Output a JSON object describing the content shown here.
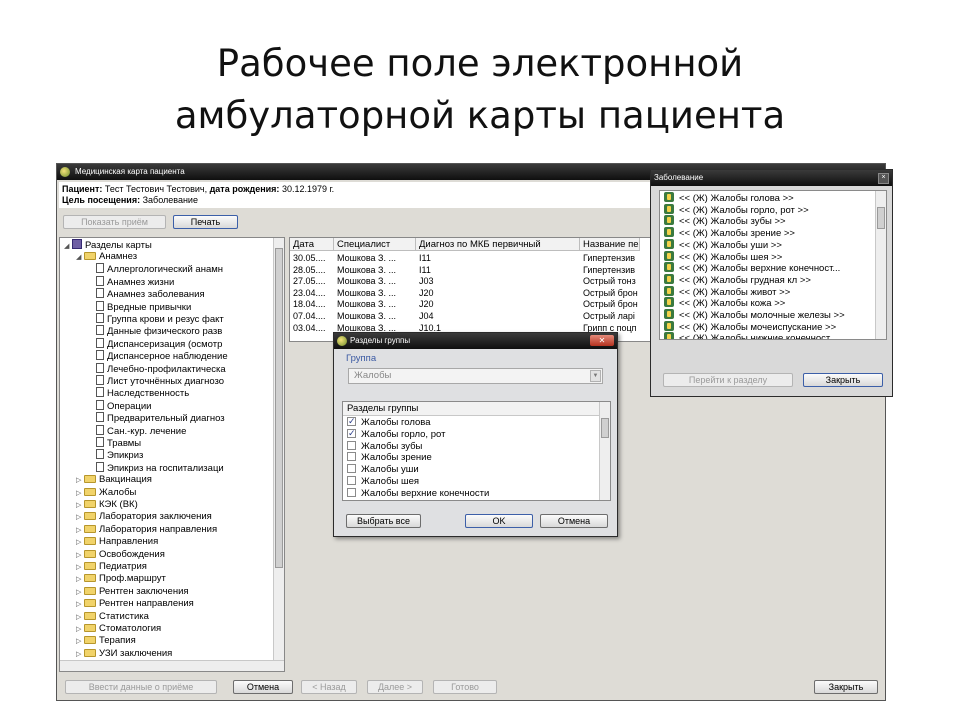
{
  "slide": {
    "title_line1": "Рабочее поле электронной",
    "title_line2": "амбулаторной карты пациента"
  },
  "main_window": {
    "title": "Медицинская карта пациента",
    "patient_label": "Пациент:",
    "patient_name": "Тест Тестович Тестович,",
    "birth_label": "дата рождения:",
    "birth_date": "30.12.1979 г.",
    "visit_label": "Цель посещения:",
    "visit_value": "Заболевание",
    "show_visit_button": "Показать приём",
    "print_button": "Печать",
    "bottom": {
      "enter_data": "Ввести данные о приёме",
      "cancel": "Отмена",
      "back": "< Назад",
      "next": "Далее >",
      "done": "Готово",
      "close": "Закрыть"
    }
  },
  "tree": {
    "root": "Разделы карты",
    "items": [
      {
        "label": "Анамнез",
        "type": "folder",
        "level": 1,
        "expanded": true
      },
      {
        "label": "Аллергологический анамн",
        "type": "doc",
        "level": 2
      },
      {
        "label": "Анамнез жизни",
        "type": "doc",
        "level": 2
      },
      {
        "label": "Анамнез заболевания",
        "type": "doc",
        "level": 2
      },
      {
        "label": "Вредные привычки",
        "type": "doc",
        "level": 2
      },
      {
        "label": "Группа крови и резус факт",
        "type": "doc",
        "level": 2
      },
      {
        "label": "Данные физического разв",
        "type": "doc",
        "level": 2
      },
      {
        "label": "Диспансеризация (осмотр",
        "type": "doc",
        "level": 2
      },
      {
        "label": "Диспансерное наблюдение",
        "type": "doc",
        "level": 2
      },
      {
        "label": "Лечебно-профилактическа",
        "type": "doc",
        "level": 2
      },
      {
        "label": "Лист уточнённых диагнозо",
        "type": "doc",
        "level": 2
      },
      {
        "label": "Наследственность",
        "type": "doc",
        "level": 2
      },
      {
        "label": "Операции",
        "type": "doc",
        "level": 2
      },
      {
        "label": "Предварительный диагноз",
        "type": "doc",
        "level": 2
      },
      {
        "label": "Сан.-кур. лечение",
        "type": "doc",
        "level": 2
      },
      {
        "label": "Травмы",
        "type": "doc",
        "level": 2
      },
      {
        "label": "Эпикриз",
        "type": "doc",
        "level": 2
      },
      {
        "label": "Эпикриз на госпитализаци",
        "type": "doc",
        "level": 2
      },
      {
        "label": "Вакцинация",
        "type": "folder",
        "level": 1
      },
      {
        "label": "Жалобы",
        "type": "folder",
        "level": 1
      },
      {
        "label": "КЭК (ВК)",
        "type": "folder",
        "level": 1
      },
      {
        "label": "Лаборатория заключения",
        "type": "folder",
        "level": 1
      },
      {
        "label": "Лаборатория направления",
        "type": "folder",
        "level": 1
      },
      {
        "label": "Направления",
        "type": "folder",
        "level": 1
      },
      {
        "label": "Освобождения",
        "type": "folder",
        "level": 1
      },
      {
        "label": "Педиатрия",
        "type": "folder",
        "level": 1
      },
      {
        "label": "Проф.маршрут",
        "type": "folder",
        "level": 1
      },
      {
        "label": "Рентген заключения",
        "type": "folder",
        "level": 1
      },
      {
        "label": "Рентген направления",
        "type": "folder",
        "level": 1
      },
      {
        "label": "Статистика",
        "type": "folder",
        "level": 1
      },
      {
        "label": "Стоматология",
        "type": "folder",
        "level": 1
      },
      {
        "label": "Терапия",
        "type": "folder",
        "level": 1
      },
      {
        "label": "УЗИ заключения",
        "type": "folder",
        "level": 1
      }
    ]
  },
  "visits_table": {
    "columns": [
      "Дата",
      "Специалист",
      "Диагноз по МКБ первичный",
      "Название пе"
    ],
    "rows": [
      [
        "30.05....",
        "Мошкова З. ...",
        "I11",
        "Гипертензив"
      ],
      [
        "28.05....",
        "Мошкова З. ...",
        "I11",
        "Гипертензив"
      ],
      [
        "27.05....",
        "Мошкова З. ...",
        "J03",
        "Острый тонз"
      ],
      [
        "23.04....",
        "Мошкова З. ...",
        "J20",
        "Острый брон"
      ],
      [
        "18.04....",
        "Мошкова З. ...",
        "J20",
        "Острый брон"
      ],
      [
        "07.04....",
        "Мошкова З. ...",
        "J04",
        "Острый ларі"
      ],
      [
        "03.04....",
        "Мошкова З. ...",
        "J10.1",
        "Грипп с поцп"
      ]
    ]
  },
  "group_dialog": {
    "title": "Разделы группы",
    "group_label": "Группа",
    "group_value": "Жалобы",
    "list_header": "Разделы группы",
    "items": [
      {
        "label": "Жалобы голова",
        "checked": true
      },
      {
        "label": "Жалобы горло, рот",
        "checked": true
      },
      {
        "label": "Жалобы зубы",
        "checked": false
      },
      {
        "label": "Жалобы зрение",
        "checked": false
      },
      {
        "label": "Жалобы уши",
        "checked": false
      },
      {
        "label": "Жалобы шея",
        "checked": false
      },
      {
        "label": "Жалобы верхние конечности",
        "checked": false
      }
    ],
    "select_all": "Выбрать все",
    "ok": "OK",
    "cancel": "Отмена",
    "close": "✕"
  },
  "disease_window": {
    "title": "Заболевание",
    "close": "×",
    "items": [
      "<< (Ж) Жалобы голова >>",
      "<< (Ж) Жалобы горло, рот >>",
      "<< (Ж) Жалобы зубы >>",
      "<< (Ж) Жалобы зрение >>",
      "<< (Ж) Жалобы уши >>",
      "<< (Ж) Жалобы шея >>",
      "<< (Ж) Жалобы верхние конечност...",
      "<< (Ж) Жалобы грудная кл >>",
      "<< (Ж) Жалобы живот >>",
      "<< (Ж) Жалобы кожа >>",
      "<< (Ж) Жалобы молочные железы >>",
      "<< (Ж) Жалобы мочеиспускание >>",
      "<< (Ж) Жалобы нижние конечност"
    ],
    "goto_button": "Перейти к разделу",
    "close_button": "Закрыть"
  }
}
